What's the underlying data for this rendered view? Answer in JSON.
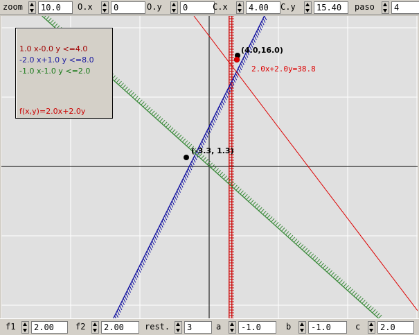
{
  "top_controls": [
    {
      "label": "zoom",
      "value": "10.0"
    },
    {
      "label": "O.x",
      "value": "0"
    },
    {
      "label": "O.y",
      "value": "0"
    },
    {
      "label": "C.x",
      "value": "4.00"
    },
    {
      "label": "C.y",
      "value": "15.40"
    },
    {
      "label": "paso",
      "value": "4"
    }
  ],
  "bottom_controls": [
    {
      "label": "f1",
      "value": "2.00"
    },
    {
      "label": "f2",
      "value": "2.00"
    },
    {
      "label": "rest.",
      "value": "3"
    },
    {
      "label": "a",
      "value": "-1.0"
    },
    {
      "label": "b",
      "value": "-1.0"
    },
    {
      "label": "c",
      "value": "2.0"
    }
  ],
  "info_box": {
    "constraints": [
      {
        "text": "1.0 x-0.0 y <=4.0",
        "color": "#a00000"
      },
      {
        "text": "-2.0 x+1.0 y <=8.0",
        "color": "#1a1aa0"
      },
      {
        "text": "-1.0 x-1.0 y <=2.0",
        "color": "#1a7a1a"
      }
    ],
    "objective": {
      "text": "f(x,y)=2.0x+2.0y",
      "color": "#cc0000"
    }
  },
  "plot": {
    "scale": "10.0",
    "origin": [
      0,
      0
    ],
    "points": [
      {
        "x": 4.0,
        "y": 16.0,
        "label": "(4.0,16.0)"
      },
      {
        "x": -3.3,
        "y": 1.3,
        "label": "(-3.3, 1.3)"
      }
    ],
    "level_line_label": "2.0x+2.0y=38.8",
    "colors": {
      "background": "#e0e0e0",
      "grid": "#ffffff",
      "axis": "#000000",
      "c1": "#cc0000",
      "c2": "#1010a0",
      "c3": "#3a8a3a",
      "objective": "#dd0000"
    }
  }
}
